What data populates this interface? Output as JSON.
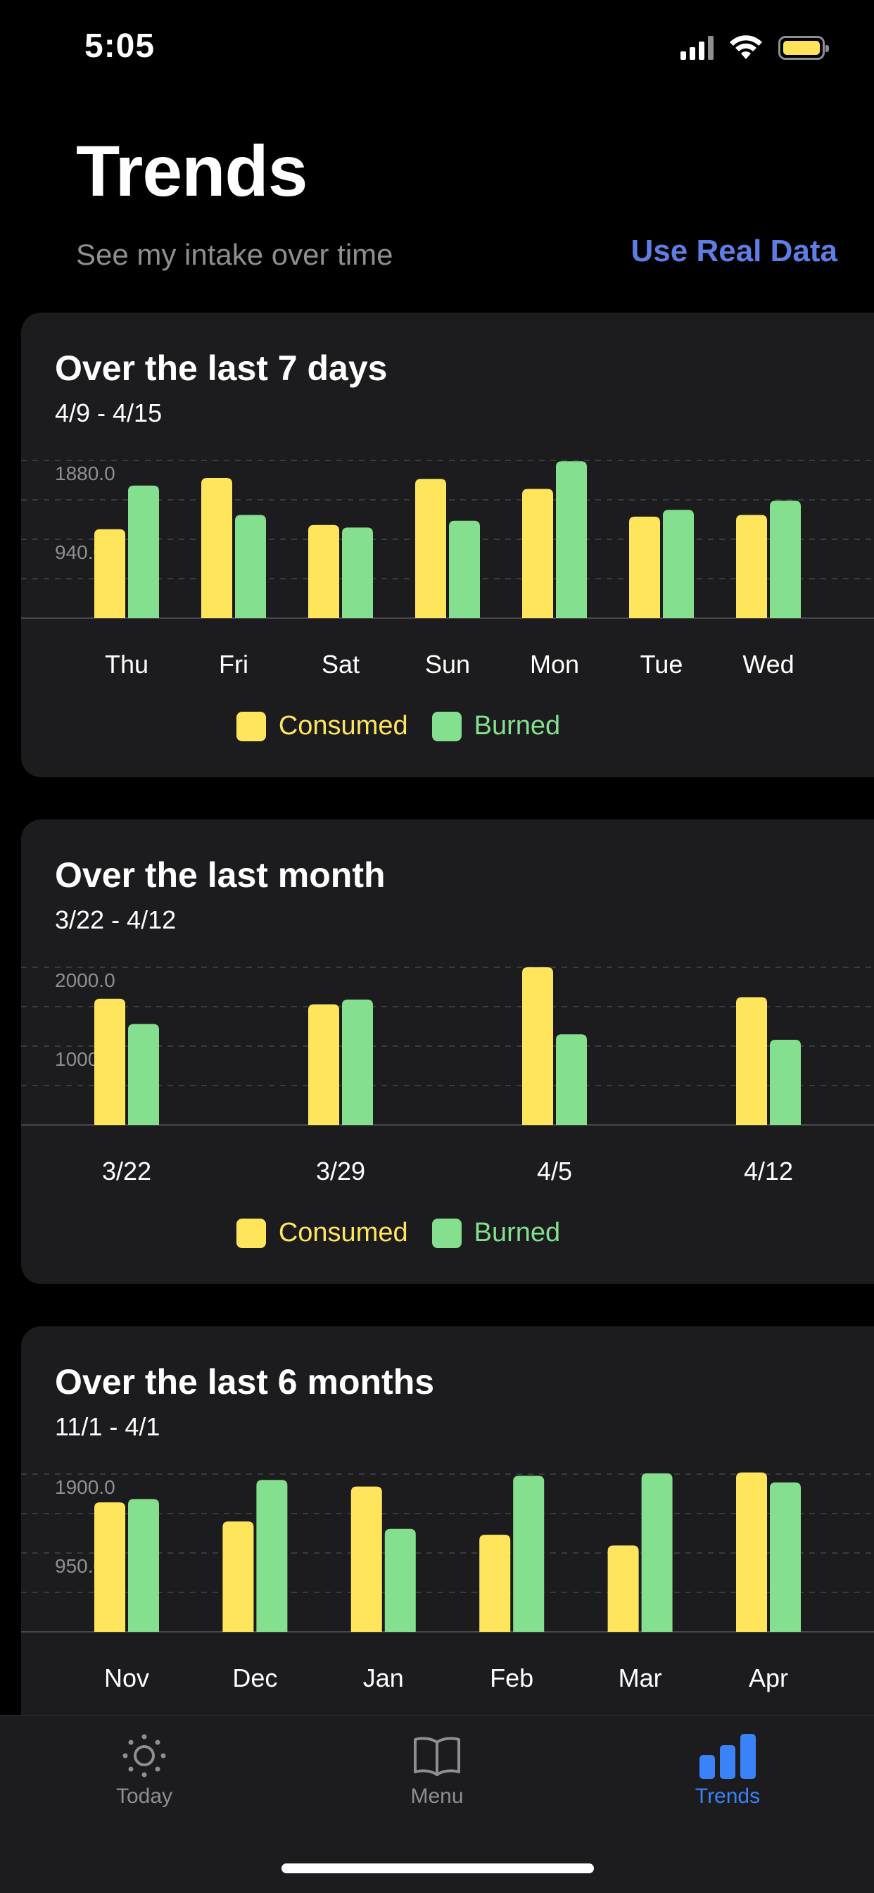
{
  "status_bar": {
    "time": "5:05",
    "signal_icon": "cellular-signal-icon",
    "wifi_icon": "wifi-icon",
    "battery_icon": "battery-icon",
    "battery_color": "#FFE15A"
  },
  "header": {
    "title": "Trends",
    "subtitle": "See my intake over time",
    "action_label": "Use Real Data"
  },
  "colors": {
    "consumed": "#FFE55C",
    "burned": "#84E08E",
    "accent": "#5E7EE6",
    "tab_active": "#3a82f7"
  },
  "legend": {
    "consumed": "Consumed",
    "burned": "Burned"
  },
  "cards": [
    {
      "title": "Over the last 7 days",
      "range": "4/9 - 4/15",
      "chart_data": {
        "type": "bar",
        "categories": [
          "Thu",
          "Fri",
          "Sat",
          "Sun",
          "Mon",
          "Tue",
          "Wed"
        ],
        "series": [
          {
            "name": "Consumed",
            "values": [
              1060,
              1670,
              1110,
              1660,
              1540,
              1210,
              1230
            ]
          },
          {
            "name": "Burned",
            "values": [
              1580,
              1230,
              1080,
              1160,
              1870,
              1290,
              1400
            ]
          }
        ],
        "ytick_labels": [
          "1880.0",
          "940.0"
        ],
        "ylim": [
          0,
          1880
        ],
        "grid": true,
        "legend": "bottom"
      }
    },
    {
      "title": "Over the last month",
      "range": "3/22 - 4/12",
      "chart_data": {
        "type": "bar",
        "categories": [
          "3/22",
          "3/29",
          "4/5",
          "4/12"
        ],
        "series": [
          {
            "name": "Consumed",
            "values": [
              1600,
              1530,
              2000,
              1620
            ]
          },
          {
            "name": "Burned",
            "values": [
              1280,
              1590,
              1150,
              1080
            ]
          }
        ],
        "ytick_labels": [
          "2000.0",
          "1000.0"
        ],
        "ylim": [
          0,
          2000
        ],
        "grid": true,
        "legend": "bottom"
      }
    },
    {
      "title": "Over the last 6 months",
      "range": "11/1 - 4/1",
      "chart_data": {
        "type": "bar",
        "categories": [
          "Nov",
          "Dec",
          "Jan",
          "Feb",
          "Mar",
          "Apr"
        ],
        "series": [
          {
            "name": "Consumed",
            "values": [
              1560,
              1330,
              1750,
              1170,
              1040,
              1920
            ]
          },
          {
            "name": "Burned",
            "values": [
              1600,
              1830,
              1240,
              1880,
              1910,
              1800
            ]
          }
        ],
        "ytick_labels": [
          "1900.0",
          "950.0"
        ],
        "ylim": [
          0,
          1900
        ],
        "grid": true,
        "legend": "bottom"
      }
    }
  ],
  "tab_bar": {
    "tabs": [
      {
        "label": "Today",
        "icon": "sun-icon",
        "active": false
      },
      {
        "label": "Menu",
        "icon": "book-icon",
        "active": false
      },
      {
        "label": "Trends",
        "icon": "bar-chart-icon",
        "active": true
      }
    ]
  }
}
